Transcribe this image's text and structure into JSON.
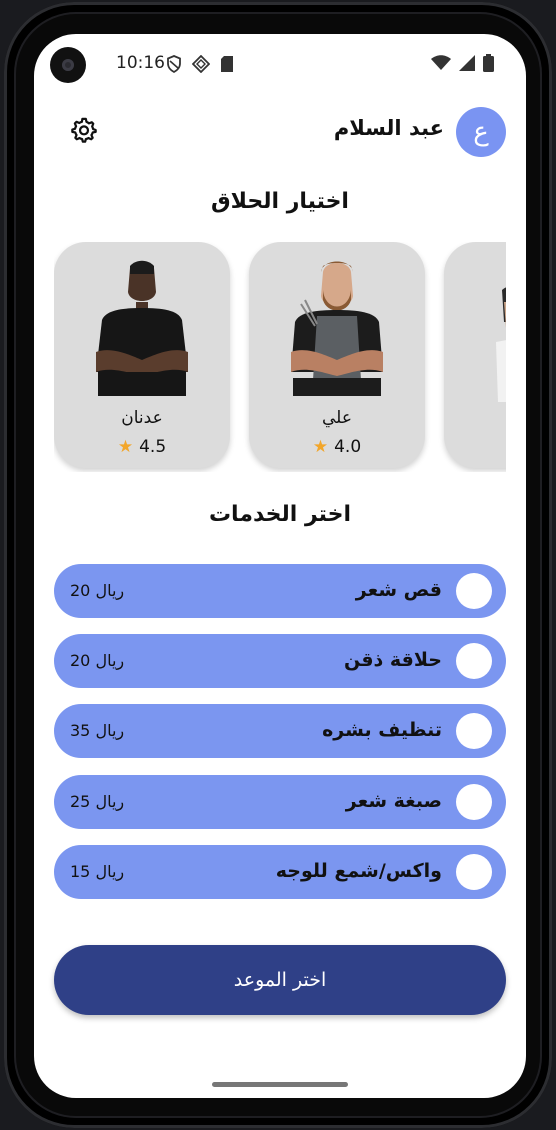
{
  "status_bar": {
    "time": "10:16"
  },
  "header": {
    "user_name": "عبد السلام",
    "avatar_initial": "ع"
  },
  "barber_section": {
    "title": "اختيار الحلاق",
    "barbers": [
      {
        "name": "عدنان",
        "rating": "4.5"
      },
      {
        "name": "علي",
        "rating": "4.0"
      }
    ]
  },
  "services_section": {
    "title": "اختر الخدمات",
    "services": [
      {
        "name": "قص شعر",
        "price": "ريال 20"
      },
      {
        "name": "حلاقة ذقن",
        "price": "ريال 20"
      },
      {
        "name": "تنظيف بشره",
        "price": "ريال 35"
      },
      {
        "name": "صبغة شعر",
        "price": "ريال 25"
      },
      {
        "name": "واكس/شمع للوجه",
        "price": "ريال 15"
      }
    ]
  },
  "cta": {
    "label": "اختر الموعد"
  },
  "colors": {
    "accent": "#7b96f0",
    "primary_button": "#2f4087",
    "avatar": "#7a94f2",
    "star": "#f2a62a"
  },
  "icons": [
    "settings-gear-icon",
    "star-icon",
    "radio-circle-icon",
    "wifi-icon",
    "signal-icon",
    "battery-icon"
  ]
}
